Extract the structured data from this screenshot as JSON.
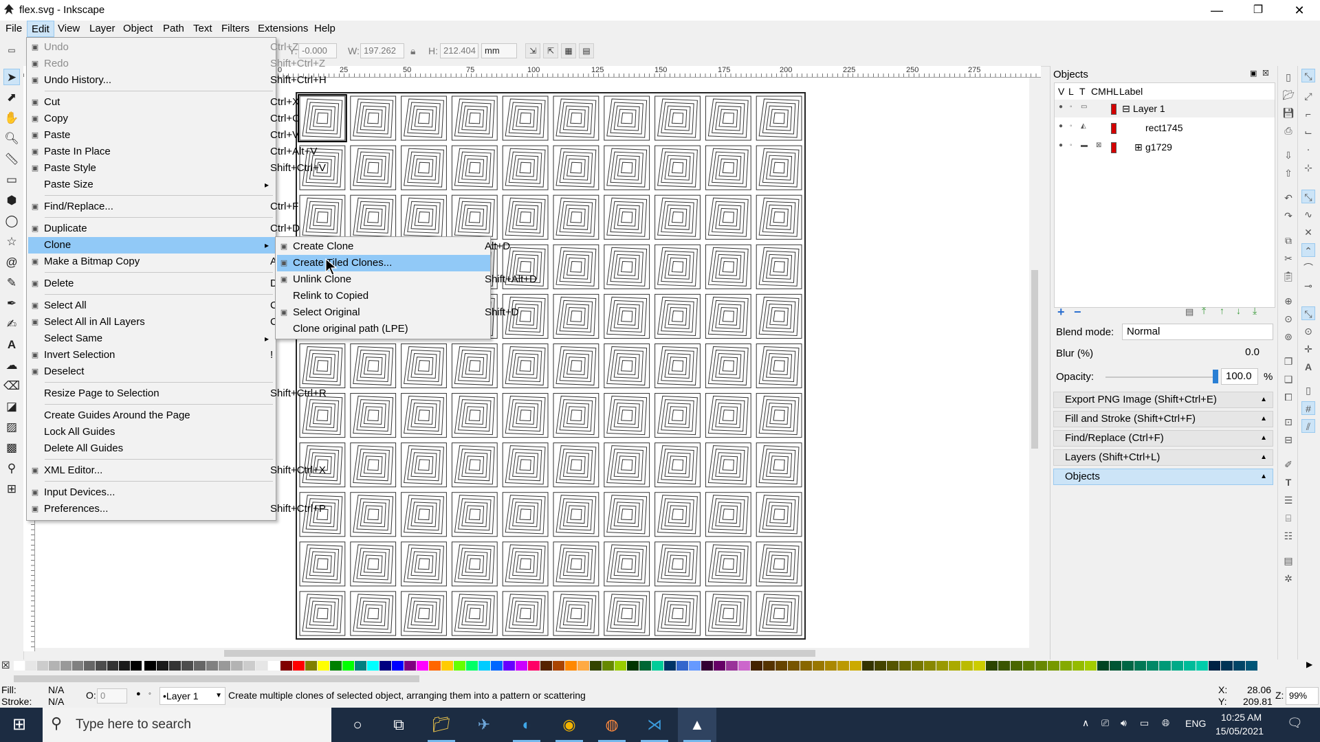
{
  "window": {
    "title": "flex.svg - Inkscape",
    "minimize": "—",
    "maximize": "❐",
    "close": "✕"
  },
  "menubar": [
    "File",
    "Edit",
    "View",
    "Layer",
    "Object",
    "Path",
    "Text",
    "Filters",
    "Extensions",
    "Help"
  ],
  "toolbar": {
    "y_label": "Y:",
    "y_value": "-0.000",
    "w_label": "W:",
    "w_value": "197.262",
    "h_label": "H:",
    "h_value": "212.404",
    "unit": "mm"
  },
  "ruler_labels": [
    "0",
    "25",
    "50",
    "75",
    "100",
    "125",
    "150",
    "175",
    "200",
    "225",
    "250",
    "275"
  ],
  "edit_menu": [
    {
      "label": "Undo",
      "shortcut": "Ctrl+Z",
      "disabled": true,
      "icon": "undo-icon"
    },
    {
      "label": "Redo",
      "shortcut": "Shift+Ctrl+Z",
      "disabled": true,
      "icon": "redo-icon"
    },
    {
      "label": "Undo History...",
      "shortcut": "Shift+Ctrl+H",
      "icon": "history-icon"
    },
    {
      "sep": true
    },
    {
      "label": "Cut",
      "shortcut": "Ctrl+X",
      "icon": "cut-icon"
    },
    {
      "label": "Copy",
      "shortcut": "Ctrl+C",
      "icon": "copy-icon"
    },
    {
      "label": "Paste",
      "shortcut": "Ctrl+V",
      "icon": "paste-icon"
    },
    {
      "label": "Paste In Place",
      "shortcut": "Ctrl+Alt+V",
      "icon": "paste-in-place-icon"
    },
    {
      "label": "Paste Style",
      "shortcut": "Shift+Ctrl+V",
      "icon": "paste-style-icon"
    },
    {
      "label": "Paste Size",
      "shortcut": "",
      "submenu": true
    },
    {
      "sep": true
    },
    {
      "label": "Find/Replace...",
      "shortcut": "Ctrl+F",
      "icon": "find-icon"
    },
    {
      "sep": true
    },
    {
      "label": "Duplicate",
      "shortcut": "Ctrl+D",
      "icon": "duplicate-icon"
    },
    {
      "label": "Clone",
      "shortcut": "",
      "submenu": true,
      "highlight": true
    },
    {
      "label": "Make a Bitmap Copy",
      "shortcut": "Alt+B",
      "icon": "bitmap-copy-icon"
    },
    {
      "sep": true
    },
    {
      "label": "Delete",
      "shortcut": "Delete",
      "icon": "delete-icon"
    },
    {
      "sep": true
    },
    {
      "label": "Select All",
      "shortcut": "Ctrl+A",
      "icon": "select-all-icon"
    },
    {
      "label": "Select All in All Layers",
      "shortcut": "Ctrl+Alt+A",
      "icon": "select-all-layers-icon"
    },
    {
      "label": "Select Same",
      "shortcut": "",
      "submenu": true
    },
    {
      "label": "Invert Selection",
      "shortcut": "!",
      "icon": "invert-selection-icon"
    },
    {
      "label": "Deselect",
      "shortcut": "",
      "icon": "deselect-icon"
    },
    {
      "sep": true
    },
    {
      "label": "Resize Page to Selection",
      "shortcut": "Shift+Ctrl+R"
    },
    {
      "sep": true
    },
    {
      "label": "Create Guides Around the Page",
      "shortcut": ""
    },
    {
      "label": "Lock All Guides",
      "shortcut": ""
    },
    {
      "label": "Delete All Guides",
      "shortcut": ""
    },
    {
      "sep": true
    },
    {
      "label": "XML Editor...",
      "shortcut": "Shift+Ctrl+X",
      "icon": "xml-editor-icon"
    },
    {
      "sep": true
    },
    {
      "label": "Input Devices...",
      "shortcut": "",
      "icon": "input-devices-icon"
    },
    {
      "label": "Preferences...",
      "shortcut": "Shift+Ctrl+P",
      "icon": "preferences-icon"
    }
  ],
  "clone_menu": [
    {
      "label": "Create Clone",
      "shortcut": "Alt+D",
      "icon": "clone-icon"
    },
    {
      "label": "Create Tiled Clones...",
      "shortcut": "",
      "icon": "tiled-clones-icon",
      "highlight": true
    },
    {
      "label": "Unlink Clone",
      "shortcut": "Shift+Alt+D",
      "icon": "unlink-clone-icon"
    },
    {
      "label": "Relink to Copied",
      "shortcut": ""
    },
    {
      "label": "Select Original",
      "shortcut": "Shift+D",
      "icon": "select-original-icon"
    },
    {
      "label": "Clone original path (LPE)",
      "shortcut": ""
    }
  ],
  "objects_panel": {
    "title": "Objects",
    "columns": [
      "V",
      "L",
      "T",
      "CM",
      "HL",
      "Label"
    ],
    "rows": [
      {
        "label": "Layer 1",
        "expander": "⊟"
      },
      {
        "label": "rect1745",
        "expander": ""
      },
      {
        "label": "g1729",
        "expander": "⊞"
      }
    ],
    "blend_label": "Blend mode:",
    "blend_value": "Normal",
    "blur_label": "Blur (%)",
    "blur_value": "0.0",
    "opacity_label": "Opacity:",
    "opacity_value": "100.0",
    "opacity_unit": "%",
    "docks": [
      "Export PNG Image (Shift+Ctrl+E)",
      "Fill and Stroke (Shift+Ctrl+F)",
      "Find/Replace (Ctrl+F)",
      "Layers (Shift+Ctrl+L)",
      "Objects"
    ]
  },
  "status": {
    "fill_label": "Fill:",
    "fill_value": "N/A",
    "stroke_label": "Stroke:",
    "stroke_value": "N/A",
    "opacity_label": "O:",
    "opacity_value": "0",
    "layer": "•Layer 1",
    "message": "Create multiple clones of selected object, arranging them into a pattern or scattering",
    "x_label": "X:",
    "x_value": "28.06",
    "y_label": "Y:",
    "y_value": "209.81",
    "zoom_label": "Z:",
    "zoom_value": "99%"
  },
  "taskbar": {
    "search_placeholder": "Type here to search",
    "language": "ENG",
    "time": "10:25 AM",
    "date": "15/05/2021"
  },
  "colors": {
    "menu_highlight": "#91c9f7",
    "panel_active": "#cce4f7",
    "layer_color": "#d40000",
    "taskbar": "#1c2c42"
  }
}
